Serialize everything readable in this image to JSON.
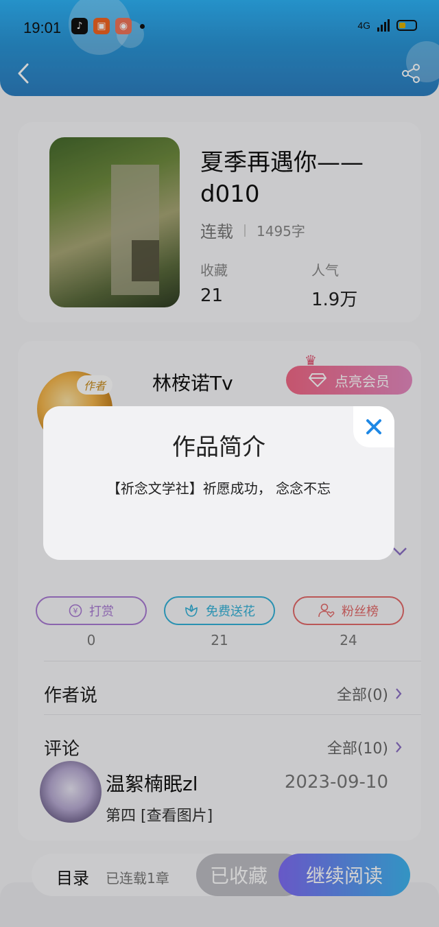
{
  "status": {
    "time": "19:01",
    "network": "4G"
  },
  "book": {
    "title": "夏季再遇你——d010",
    "status": "连载",
    "word_count": "1495字",
    "collect_label": "收藏",
    "collect_value": "21",
    "popularity_label": "人气",
    "popularity_value": "1.9万"
  },
  "author": {
    "name": "林桉诺Tv",
    "tag": "作者",
    "vip_label": "点亮会员"
  },
  "actions": [
    {
      "label": "打赏",
      "count": "0"
    },
    {
      "label": "免费送花",
      "count": "21"
    },
    {
      "label": "粉丝榜",
      "count": "24"
    }
  ],
  "sections": {
    "author_says": {
      "label": "作者说",
      "link": "全部(0)"
    },
    "comments": {
      "label": "评论",
      "link": "全部(10)"
    }
  },
  "comment": {
    "user": "温絮楠眠zl",
    "date": "2023-09-10",
    "text": "第四  [查看图片]"
  },
  "bottom": {
    "toc": "目录",
    "toc_sub": "已连载1章",
    "collected": "已收藏",
    "continue": "继续阅读"
  },
  "modal": {
    "title": "作品简介",
    "text": "【祈念文学社】祈愿成功，  念念不忘"
  },
  "icons": {
    "back": "back-icon",
    "share": "share-icon",
    "close": "close-icon",
    "reward": "yen-icon",
    "flower": "flower-icon",
    "fans": "user-heart-icon"
  }
}
